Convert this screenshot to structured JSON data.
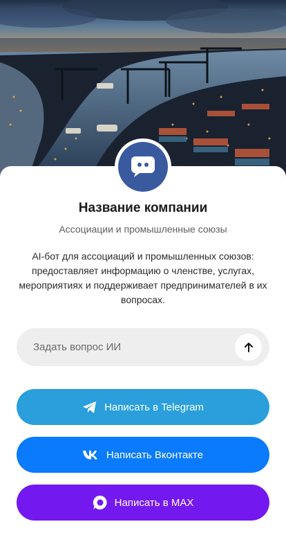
{
  "company": {
    "name": "Название компании",
    "category": "Ассоциации и промышленные союзы",
    "description": "AI-бот для ассоциаций и промышленных союзов: предоставляет информацию о членстве, услугах, мероприятиях и поддерживает предпринимателей в их вопросах."
  },
  "ask": {
    "placeholder": "Задать вопрос ИИ",
    "send_icon": "arrow-up-icon"
  },
  "buttons": {
    "telegram": {
      "label": "Написать в Telegram",
      "icon": "telegram-icon",
      "color": "#2a9fdc"
    },
    "vk": {
      "label": "Написать Вконтакте",
      "icon": "vk-icon",
      "color": "#0a7bfc"
    },
    "max": {
      "label": "Написать в MAX",
      "icon": "max-icon",
      "color": "#7418f0"
    }
  },
  "colors": {
    "avatar_bg": "#3a5aa0",
    "ask_bg": "#eeeeee"
  }
}
